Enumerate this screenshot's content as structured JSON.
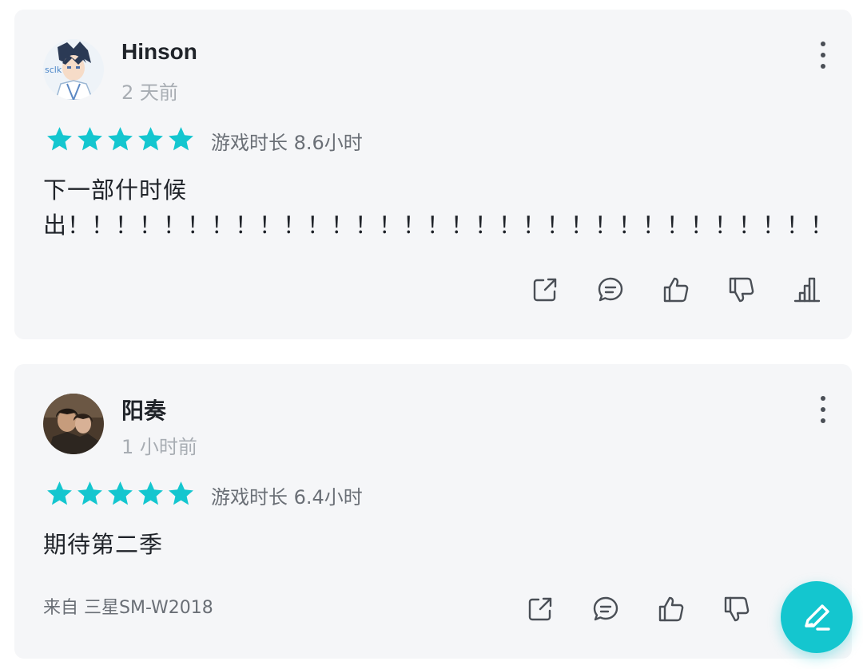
{
  "reviews": [
    {
      "author": "Hinson",
      "time": "2 天前",
      "rating": 5,
      "playtime": "游戏时长 8.6小时",
      "content": "下一部什时候\n出！！！！！！！！！！！！！！！！！！！！！！！！！！！！！！！！",
      "device": ""
    },
    {
      "author": "阳奏",
      "time": "1 小时前",
      "rating": 5,
      "playtime": "游戏时长 6.4小时",
      "content": "期待第二季",
      "device": "来自 三星SM-W2018"
    }
  ],
  "colors": {
    "accent": "#14c6cf",
    "card_bg": "#f5f6f8",
    "muted_text": "#a8adb3",
    "icon": "#4a4f56"
  },
  "icons": {
    "share": "share-icon",
    "comment": "comment-icon",
    "like": "thumbs-up-icon",
    "dislike": "thumbs-down-icon",
    "stats": "bar-chart-icon",
    "fab": "write-review-icon"
  }
}
